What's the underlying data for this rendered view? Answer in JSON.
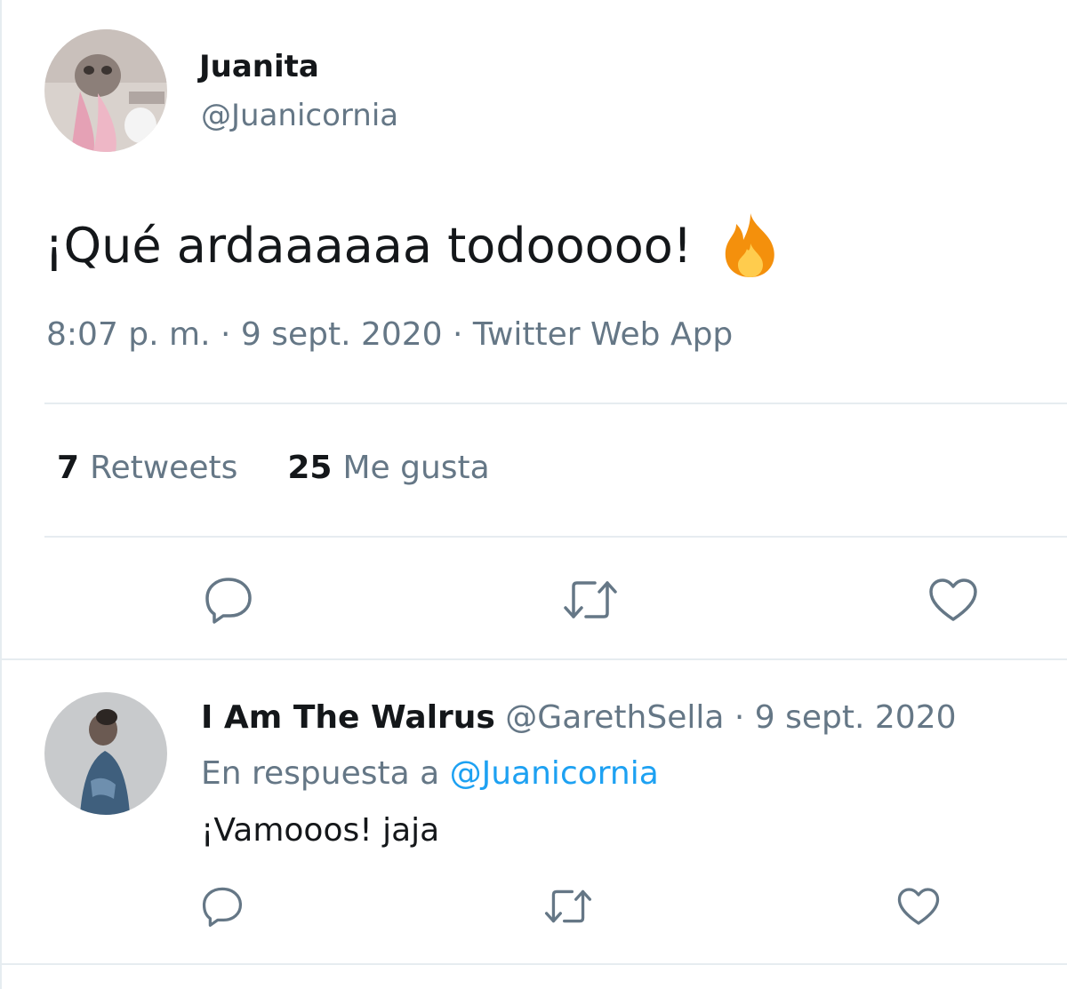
{
  "main_tweet": {
    "author_name": "Juanita",
    "author_handle": "@Juanicornia",
    "text": "¡Qué ardaaaaaa todooooo!",
    "emoji_icon": "fire-icon",
    "meta": "8:07 p. m. · 9 sept. 2020 · Twitter Web App",
    "retweets_count": "7",
    "retweets_label": "Retweets",
    "likes_count": "25",
    "likes_label": "Me gusta"
  },
  "reply": {
    "author_name": "I Am The Walrus",
    "author_handle": "@GarethSella",
    "separator": "·",
    "date": "9 sept. 2020",
    "reply_to_label": "En respuesta a",
    "reply_to_mention": "@Juanicornia",
    "text": "¡Vamooos! jaja"
  },
  "icons": {
    "reply": "reply-icon",
    "retweet": "retweet-icon",
    "like": "heart-icon"
  },
  "colors": {
    "text_primary": "#14171a",
    "text_secondary": "#657786",
    "accent": "#1da1f2",
    "divider": "#e6ecf0",
    "icon_gray": "#657786"
  }
}
